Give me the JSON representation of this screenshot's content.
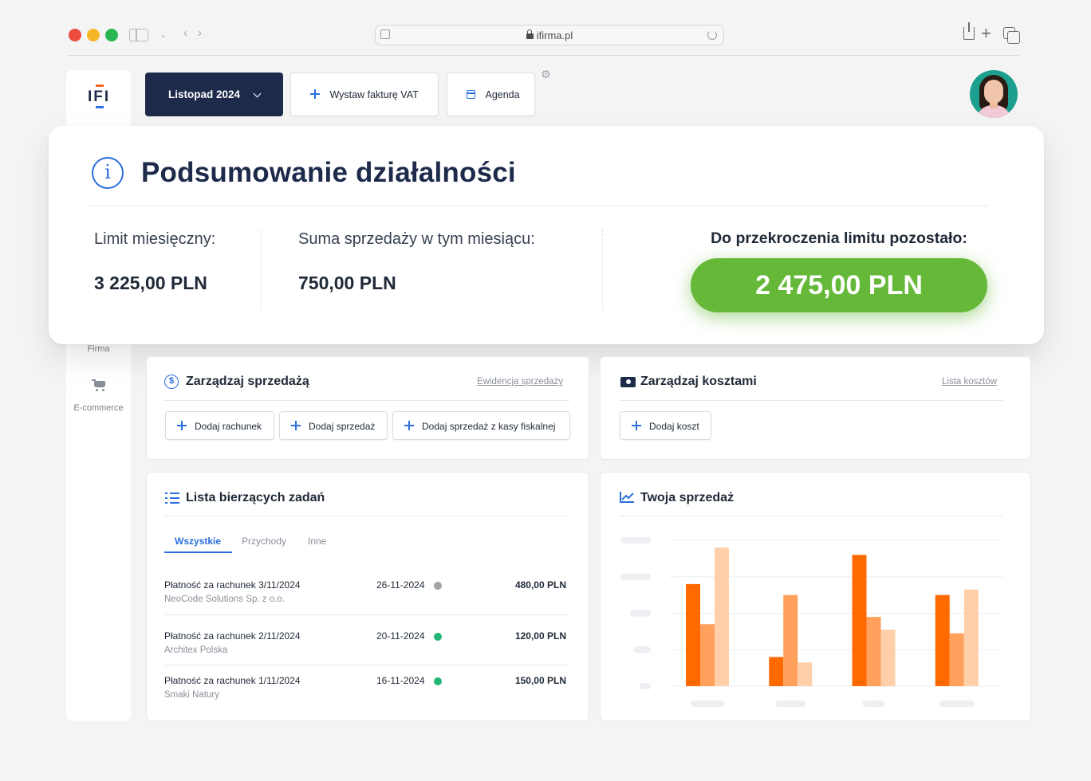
{
  "browser": {
    "url": "ifirma.pl"
  },
  "sidebar": {
    "items": [
      {
        "label": "Firma"
      },
      {
        "label": "E-commerce"
      }
    ],
    "logo_text": "IFI"
  },
  "toolbar": {
    "month_label": "Listopad 2024",
    "invoice_label": "Wystaw fakturę VAT",
    "agenda_label": "Agenda"
  },
  "summary": {
    "title": "Podsumowanie działalności",
    "limit_label": "Limit miesięczny:",
    "limit_value": "3 225,00 PLN",
    "sales_label": "Suma sprzedaży w tym miesiącu:",
    "sales_value": "750,00 PLN",
    "remaining_label": "Do przekroczenia limitu pozostało:",
    "remaining_value": "2 475,00 PLN",
    "remaining_color": "#66b839"
  },
  "sales_panel": {
    "title": "Zarządzaj sprzedażą",
    "link": "Ewidencja sprzedaży",
    "buttons": [
      "Dodaj rachunek",
      "Dodaj sprzedaż",
      "Dodaj sprzedaż z kasy fiskalnej"
    ]
  },
  "costs_panel": {
    "title": "Zarządzaj kosztami",
    "link": "Lista kosztów",
    "buttons": [
      "Dodaj koszt"
    ]
  },
  "tasks_panel": {
    "title": "Lista bierzących zadań",
    "tabs": [
      "Wszystkie",
      "Przychody",
      "Inne"
    ],
    "active_tab": "Wszystkie",
    "rows": [
      {
        "title": "Płatność za rachunek 3/11/2024",
        "company": "NeoCode Solutions Sp. z o.o.",
        "date": "26-11-2024",
        "status": "pending",
        "status_color": "#a3a3a8",
        "amount": "480,00 PLN"
      },
      {
        "title": "Płatność za rachunek 2/11/2024",
        "company": "Architex Polska",
        "date": "20-11-2024",
        "status": "paid",
        "status_color": "#22b573",
        "amount": "120,00 PLN"
      },
      {
        "title": "Płatność za rachunek 1/11/2024",
        "company": "Smaki Natury",
        "date": "16-11-2024",
        "status": "paid",
        "status_color": "#22b573",
        "amount": "150,00 PLN"
      }
    ]
  },
  "chart_panel": {
    "title": "Twoja sprzedaż"
  },
  "chart_data": {
    "type": "bar",
    "title": "",
    "xlabel": "",
    "ylabel": "",
    "categories": [
      "",
      "",
      "",
      ""
    ],
    "ylim": [
      0,
      4
    ],
    "grid": true,
    "legend": "none",
    "series": [
      {
        "values": [
          2.8,
          0.8,
          3.6,
          2.5
        ],
        "color": "#ff6a00"
      },
      {
        "values": [
          1.7,
          2.5,
          1.9,
          1.45
        ],
        "color": "#ffa15c"
      },
      {
        "values": [
          3.8,
          0.65,
          1.55,
          2.65
        ],
        "color": "#ffcfaa"
      }
    ]
  }
}
